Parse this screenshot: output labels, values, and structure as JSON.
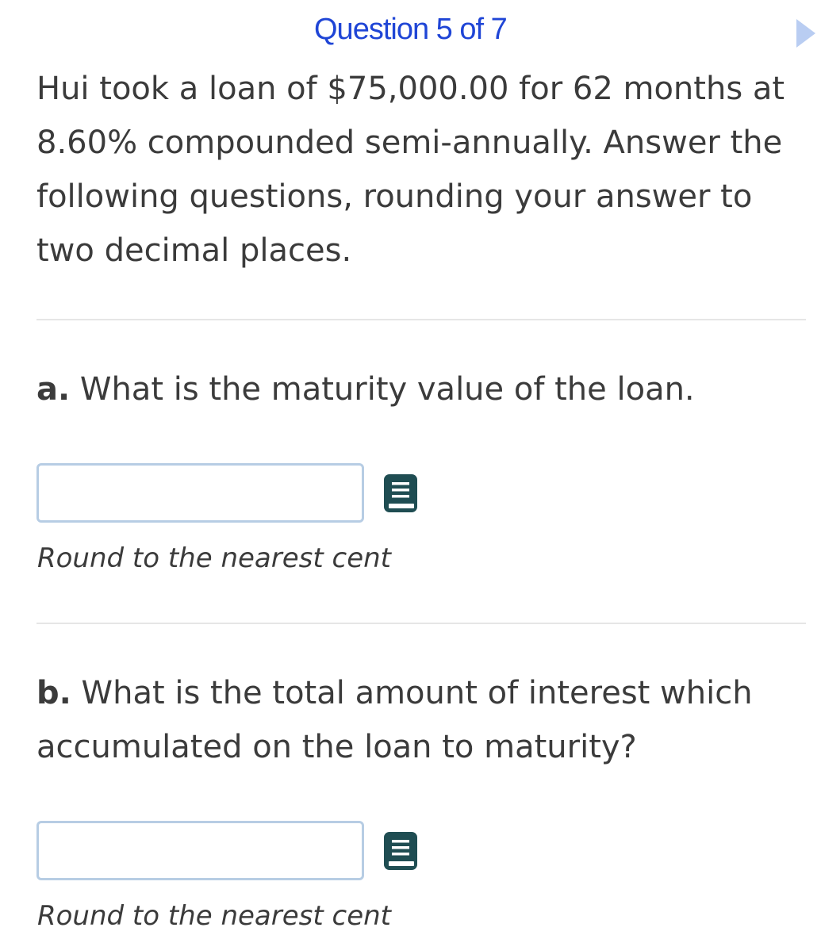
{
  "header": {
    "question_counter": "Question 5 of 7",
    "next_icon": "triangle-right-icon"
  },
  "prompt": "Hui took a loan of $75,000.00 for 62 months at 8.60% compounded semi-annually. Answer the following questions, rounding your answer to two decimal places.",
  "parts": [
    {
      "letter": "a.",
      "question": " What is the maturity value of the loan.",
      "input_value": "",
      "icon": "book-icon",
      "hint": "Round to the nearest cent"
    },
    {
      "letter": "b.",
      "question": " What is the total amount of interest which accumulated on the loan to maturity?",
      "input_value": "",
      "icon": "book-icon",
      "hint": "Round to the nearest cent"
    }
  ],
  "colors": {
    "accent": "#1f45d6",
    "arrow": "#b9cdf2",
    "input_border": "#b7cde4",
    "icon": "#1f4d52",
    "text": "#3b3b3b"
  }
}
